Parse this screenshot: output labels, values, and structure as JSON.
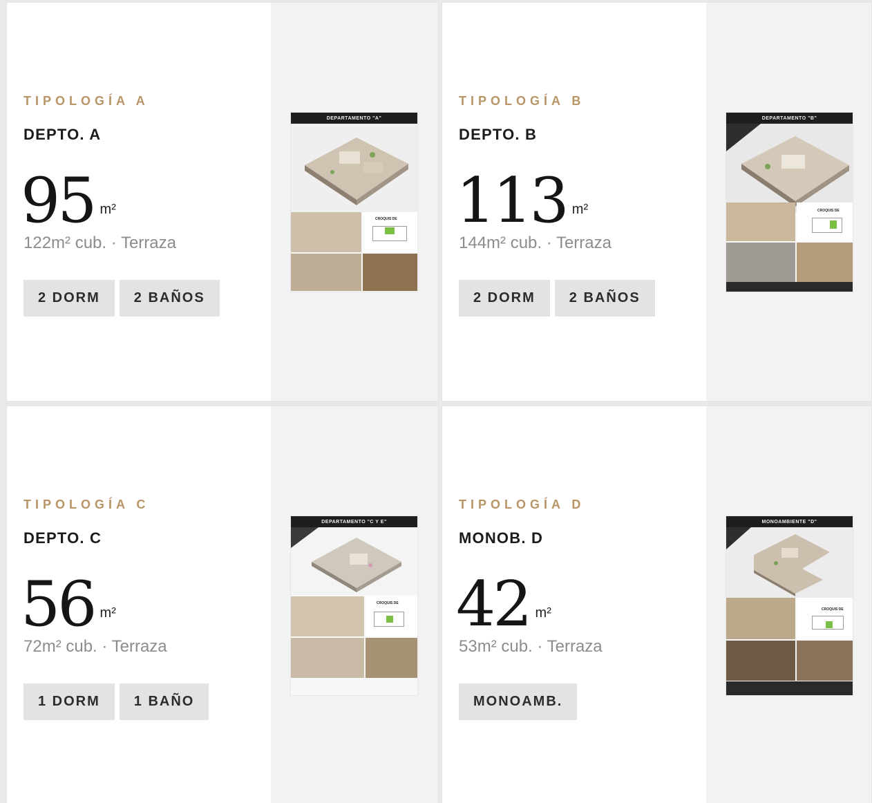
{
  "cards": [
    {
      "eyebrow": "TIPOLOGÍA A",
      "title": "DEPTO. A",
      "area": "95",
      "unit": "m²",
      "sub": "122m² cub. · Terraza",
      "tags": [
        "2 DORM",
        "2 BAÑOS"
      ],
      "thumb": {
        "header": "DEPARTAMENTO \"A\"",
        "croquis": "CROQUIS DE"
      }
    },
    {
      "eyebrow": "TIPOLOGÍA B",
      "title": "DEPTO. B",
      "area": "113",
      "unit": "m²",
      "sub": "144m² cub. · Terraza",
      "tags": [
        "2 DORM",
        "2 BAÑOS"
      ],
      "thumb": {
        "header": "DEPARTAMENTO \"B\"",
        "croquis": "CROQUIS DE"
      }
    },
    {
      "eyebrow": "TIPOLOGÍA C",
      "title": "DEPTO. C",
      "area": "56",
      "unit": "m²",
      "sub": "72m² cub. · Terraza",
      "tags": [
        "1 DORM",
        "1 BAÑO"
      ],
      "thumb": {
        "header": "DEPARTAMENTO \"C Y E\"",
        "croquis": "CROQUIS DE"
      }
    },
    {
      "eyebrow": "TIPOLOGÍA D",
      "title": "MONOB. D",
      "area": "42",
      "unit": "m²",
      "sub": "53m² cub. · Terraza",
      "tags": [
        "MONOAMB."
      ],
      "thumb": {
        "header": "MONOAMBIENTE \"D\"",
        "croquis": "CROQUIS DE"
      }
    }
  ],
  "colors": {
    "accent": "#b89567",
    "tag_bg": "#e3e3e3",
    "media_bg": "#f2f2f2"
  }
}
